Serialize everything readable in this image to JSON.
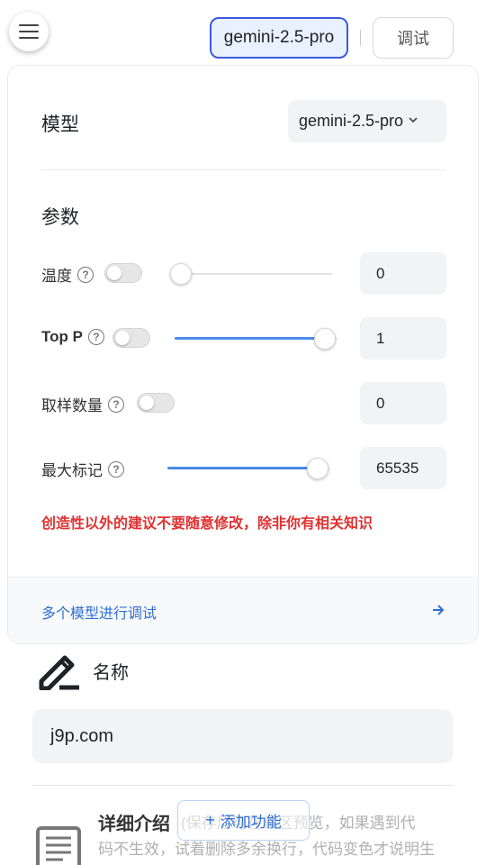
{
  "header": {
    "model_button": "gemini-2.5-pro",
    "debug_button": "调试"
  },
  "panel": {
    "model_label": "模型",
    "model_value": "gemini-2.5-pro",
    "params_title": "参数",
    "params": {
      "temperature": {
        "label": "温度",
        "value": "0",
        "enabled": false,
        "slider_fraction": 0
      },
      "top_p": {
        "label": "Top P",
        "value": "1",
        "enabled": false,
        "slider_fraction": 1
      },
      "samples": {
        "label": "取样数量",
        "value": "0",
        "enabled": false
      },
      "max_tokens": {
        "label": "最大标记",
        "value": "65535",
        "slider_fraction": 1
      }
    },
    "help_glyph": "?",
    "warning": "创造性以外的建议不要随意修改，除非你有相关知识",
    "multi_model_link": "多个模型进行调试",
    "arrow": "→"
  },
  "form": {
    "name_label": "名称",
    "name_value": "j9p.com",
    "detail_title": "详细介绍",
    "detail_desc_line1": "(保存后可在试区预览，如果遇到代",
    "detail_desc_line2": "码不生效，试着删除多余换行，代码变色才说明生",
    "add_feature_plus": "+",
    "add_feature": "添加功能"
  },
  "colors": {
    "accent": "#3b5bdb",
    "link": "#2f6fd6",
    "slider": "#4a8bea",
    "warning": "#e03131"
  }
}
